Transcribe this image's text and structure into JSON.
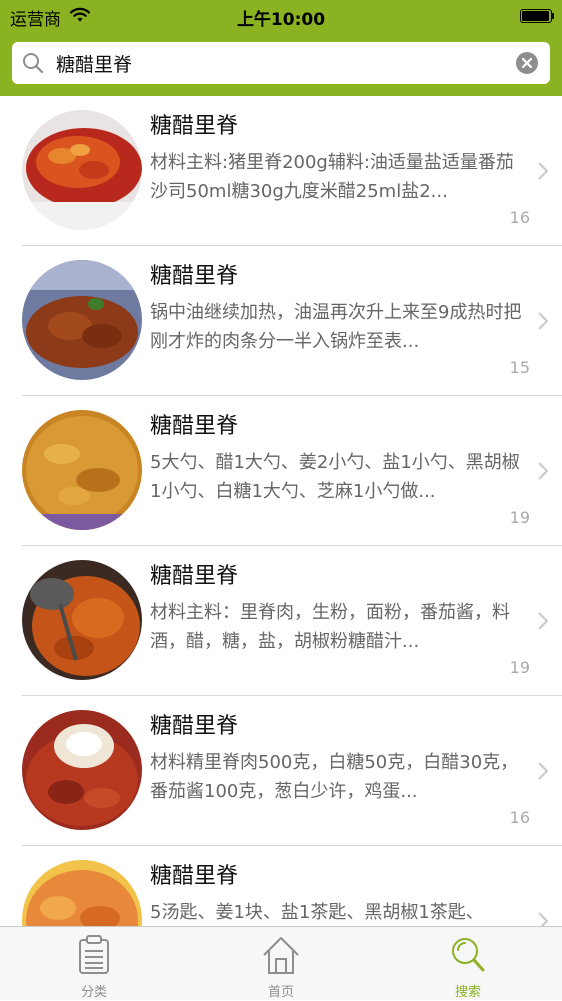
{
  "status_bar": {
    "carrier": "运营商",
    "time": "上午10:00"
  },
  "search": {
    "value": "糖醋里脊"
  },
  "results": [
    {
      "title": "糖醋里脊",
      "desc": "材料主料:猪里脊200g辅料:油适量盐适量番茄沙司50ml糖30g九度米醋25ml盐2...",
      "count": "16"
    },
    {
      "title": "糖醋里脊",
      "desc": "锅中油继续加热，油温再次升上来至9成热时把刚才炸的肉条分一半入锅炸至表...",
      "count": "15"
    },
    {
      "title": "糖醋里脊",
      "desc": "5大勺、醋1大勺、姜2小勺、盐1小勺、黑胡椒1小勺、白糖1大勺、芝麻1小勺做...",
      "count": "19"
    },
    {
      "title": "糖醋里脊",
      "desc": "材料主料：里脊肉，生粉，面粉，番茄酱，料酒，醋，糖，盐，胡椒粉糖醋汁...",
      "count": "19"
    },
    {
      "title": "糖醋里脊",
      "desc": "材料精里脊肉500克，白糖50克，白醋30克，番茄酱100克，葱白少许，鸡蛋...",
      "count": "16"
    },
    {
      "title": "糖醋里脊",
      "desc": "5汤匙、姜1块、盐1茶匙、黑胡椒1茶匙、",
      "count": ""
    }
  ],
  "tabs": [
    {
      "label": "分类",
      "icon": "clipboard-list-icon"
    },
    {
      "label": "首页",
      "icon": "house-icon"
    },
    {
      "label": "搜索",
      "icon": "search-icon",
      "active": true
    }
  ],
  "colors": {
    "accent": "#8ab221",
    "tab_inactive": "#8e8e8e"
  }
}
